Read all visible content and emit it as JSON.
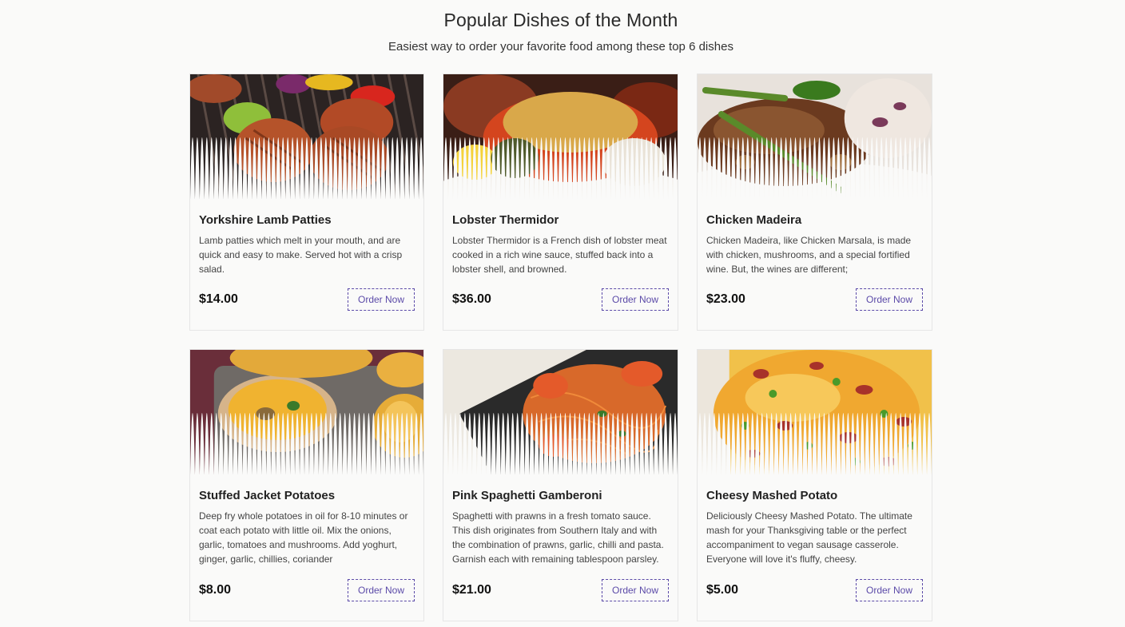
{
  "header": {
    "title": "Popular Dishes of the Month",
    "subtitle": "Easiest way to order your favorite food among these top 6 dishes"
  },
  "dishes": [
    {
      "title": "Yorkshire Lamb Patties",
      "description": "Lamb patties which melt in your mouth, and are quick and easy to make. Served hot with a crisp salad.",
      "price": "$14.00",
      "button": "Order Now",
      "image": "grilled-patties-photo"
    },
    {
      "title": "Lobster Thermidor",
      "description": "Lobster Thermidor is a French dish of lobster meat cooked in a rich wine sauce, stuffed back into a lobster shell, and browned.",
      "price": "$36.00",
      "button": "Order Now",
      "image": "lobster-photo"
    },
    {
      "title": "Chicken Madeira",
      "description": "Chicken Madeira, like Chicken Marsala, is made with chicken, mushrooms, and a special fortified wine. But, the wines are different;",
      "price": "$23.00",
      "button": "Order Now",
      "image": "chicken-mushroom-photo"
    },
    {
      "title": "Stuffed Jacket Potatoes",
      "description": "Deep fry whole potatoes in oil for 8-10 minutes or coat each potato with little oil. Mix the onions, garlic, tomatoes and mushrooms. Add yoghurt, ginger, garlic, chillies, coriander",
      "price": "$8.00",
      "button": "Order Now",
      "image": "jacket-potatoes-photo"
    },
    {
      "title": "Pink Spaghetti Gamberoni",
      "description": "Spaghetti with prawns in a fresh tomato sauce. This dish originates from Southern Italy and with the combination of prawns, garlic, chilli and pasta. Garnish each with remaining tablespoon parsley.",
      "price": "$21.00",
      "button": "Order Now",
      "image": "spaghetti-prawns-photo"
    },
    {
      "title": "Cheesy Mashed Potato",
      "description": "Deliciously Cheesy Mashed Potato. The ultimate mash for your Thanksgiving table or the perfect accompaniment to vegan sausage casserole. Everyone will love it's fluffy, cheesy.",
      "price": "$5.00",
      "button": "Order Now",
      "image": "cheesy-mash-photo"
    }
  ],
  "colors": {
    "accent": "#5b4aa8",
    "background": "#fafaf9"
  }
}
